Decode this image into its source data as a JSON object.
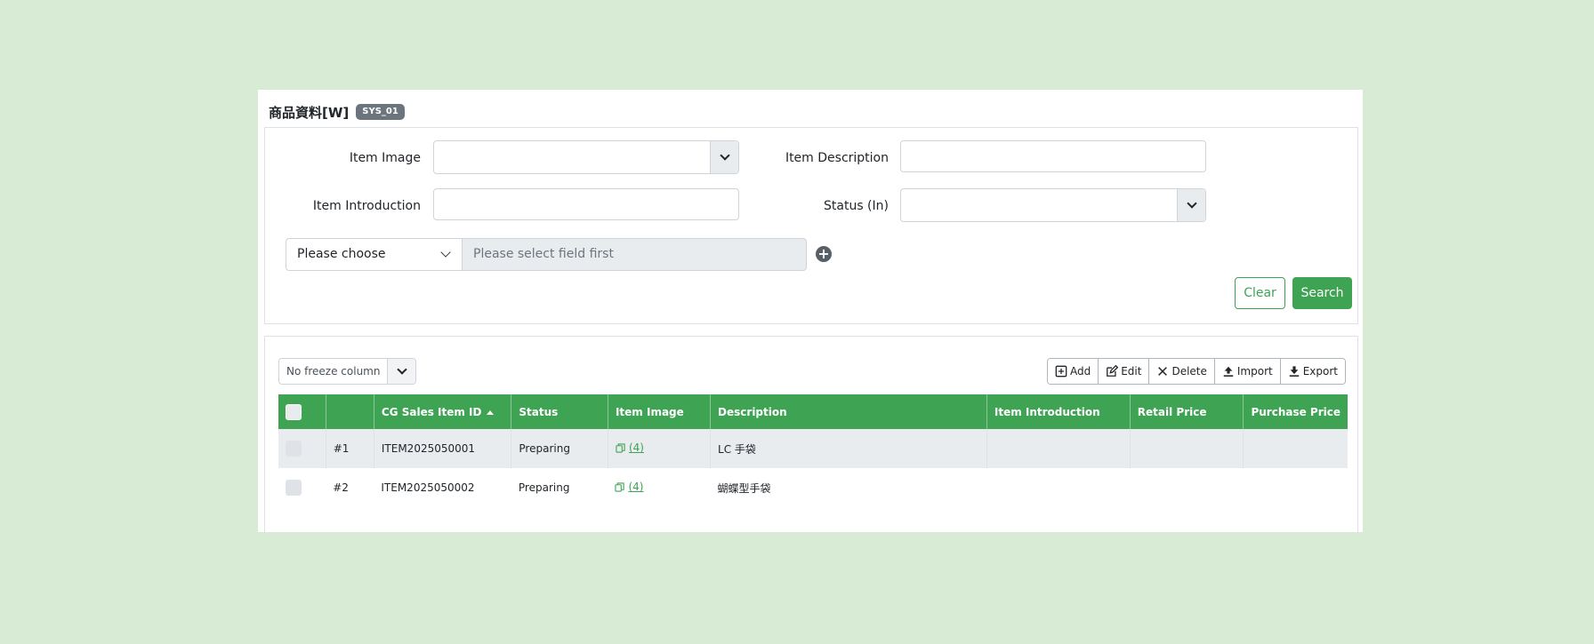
{
  "header": {
    "title": "商品資料[W]",
    "badge": "SYS_01"
  },
  "search": {
    "item_image_label": "Item Image",
    "item_image_value": "",
    "item_description_label": "Item Description",
    "item_description_value": "",
    "item_introduction_label": "Item Introduction",
    "item_introduction_value": "",
    "status_label": "Status (In)",
    "status_value": "",
    "field_choose": "Please choose",
    "field_value_placeholder": "Please select field first",
    "clear_label": "Clear",
    "search_label": "Search"
  },
  "grid": {
    "freeze_value": "No freeze column",
    "toolbar": {
      "add": "Add",
      "edit": "Edit",
      "delete": "Delete",
      "import": "Import",
      "export": "Export"
    },
    "columns": [
      "",
      "",
      "CG Sales Item ID",
      "Status",
      "Item Image",
      "Description",
      "Item Introduction",
      "Retail Price",
      "Purchase Price"
    ],
    "rows": [
      {
        "num": "#1",
        "id": "ITEM2025050001",
        "status": "Preparing",
        "image": "(4)",
        "description": "LC 手袋",
        "introduction": "",
        "retail": "",
        "purchase": ""
      },
      {
        "num": "#2",
        "id": "ITEM2025050002",
        "status": "Preparing",
        "image": "(4)",
        "description": "蝴蝶型手袋",
        "introduction": "",
        "retail": "",
        "purchase": ""
      }
    ]
  },
  "colors": {
    "accent": "#3ea454",
    "background": "#d8ecd5",
    "badge": "#6c757d"
  }
}
